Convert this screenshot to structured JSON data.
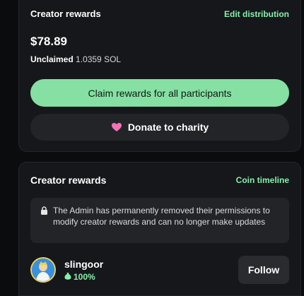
{
  "creator_rewards": {
    "title": "Creator rewards",
    "edit_link": "Edit distribution",
    "amount": "$78.89",
    "unclaimed_label": "Unclaimed",
    "unclaimed_value": "1.0359 SOL",
    "claim_button": "Claim rewards for all participants",
    "donate_button": "Donate to charity"
  },
  "creator_rewards_info": {
    "title": "Creator rewards",
    "timeline_link": "Coin timeline",
    "notice": "The Admin has permanently removed their permissions to modify creator rewards and can no longer make updates",
    "user": {
      "name": "slingoor",
      "share": "100%"
    },
    "follow_button": "Follow"
  },
  "colors": {
    "accent": "#86efac",
    "claim_bg": "#86e0a3",
    "card_bg": "#16171a",
    "page_bg": "#0b0c0e"
  },
  "icons": {
    "donate": "heart-icon",
    "notice": "lock-icon",
    "share": "money-bag-icon"
  }
}
